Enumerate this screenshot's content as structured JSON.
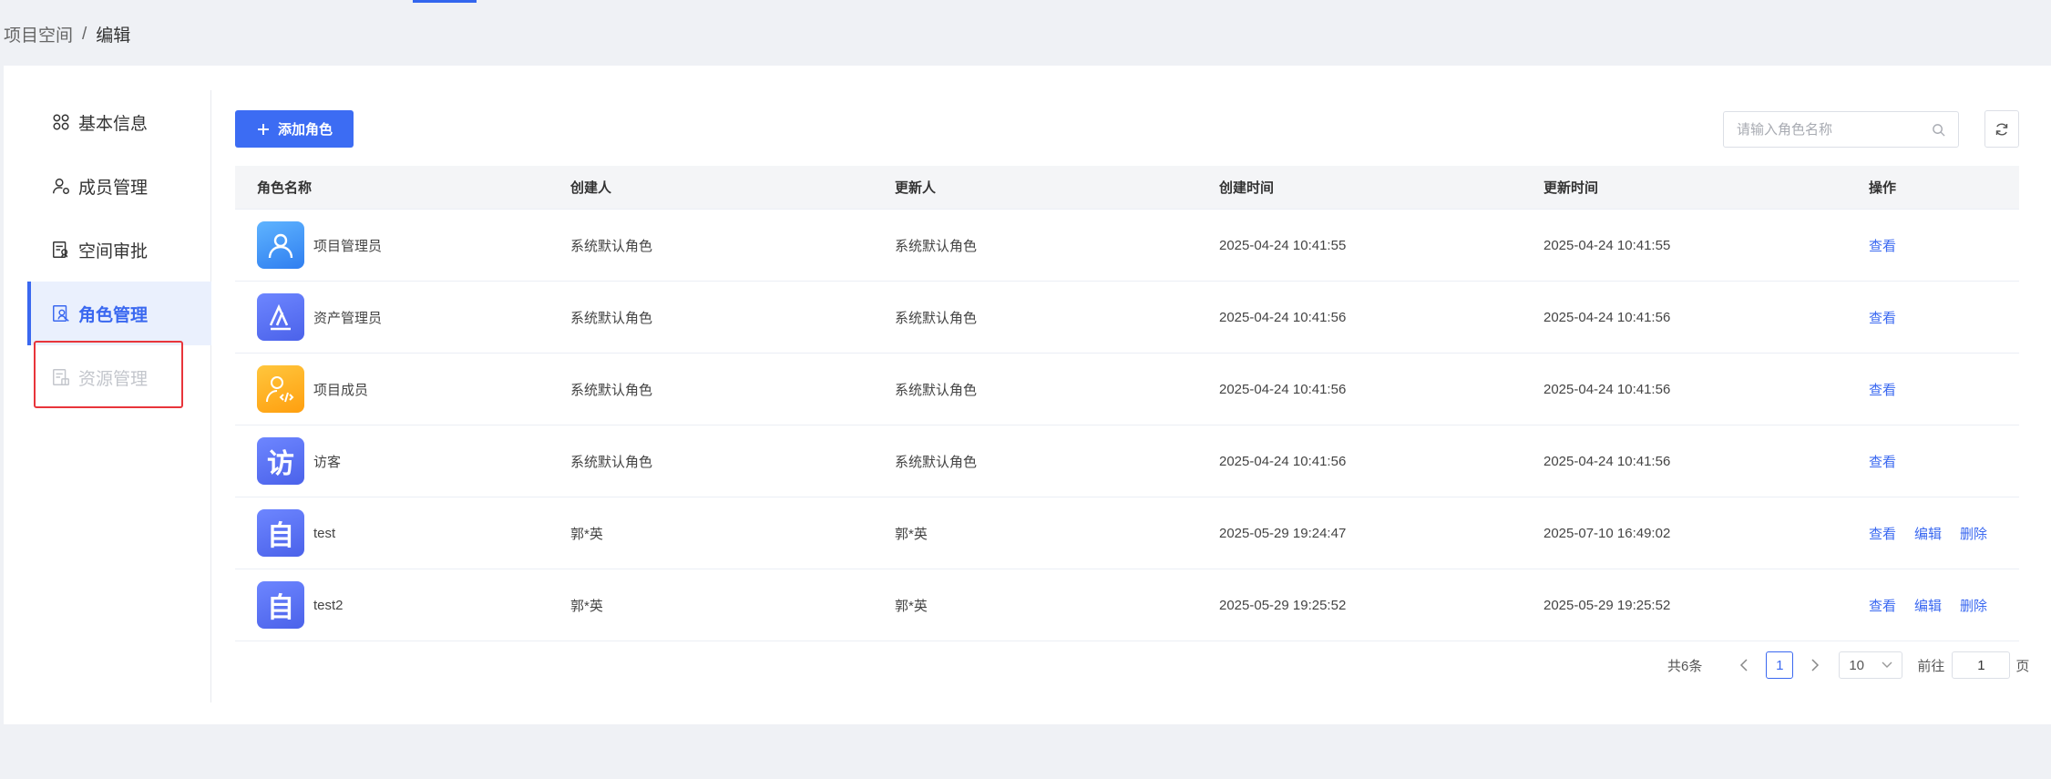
{
  "breadcrumb": {
    "parent": "项目空间",
    "separator": "/",
    "current": "编辑"
  },
  "sidebar": {
    "items": [
      {
        "label": "基本信息",
        "icon": "grid-icon",
        "state": "normal"
      },
      {
        "label": "成员管理",
        "icon": "user-settings-icon",
        "state": "normal"
      },
      {
        "label": "空间审批",
        "icon": "approval-icon",
        "state": "normal"
      },
      {
        "label": "角色管理",
        "icon": "role-icon",
        "state": "active"
      },
      {
        "label": "资源管理",
        "icon": "resource-icon",
        "state": "disabled"
      }
    ]
  },
  "toolbar": {
    "add_label": "添加角色",
    "search_placeholder": "请输入角色名称"
  },
  "table": {
    "headers": [
      "角色名称",
      "创建人",
      "更新人",
      "创建时间",
      "更新时间",
      "操作"
    ],
    "rows": [
      {
        "name": "项目管理员",
        "avatar": "person-icon",
        "creator": "系统默认角色",
        "updater": "系统默认角色",
        "created": "2025-04-24 10:41:55",
        "updated": "2025-04-24 10:41:55",
        "actions": [
          "查看"
        ]
      },
      {
        "name": "资产管理员",
        "avatar": "asset-icon",
        "creator": "系统默认角色",
        "updater": "系统默认角色",
        "created": "2025-04-24 10:41:56",
        "updated": "2025-04-24 10:41:56",
        "actions": [
          "查看"
        ]
      },
      {
        "name": "项目成员",
        "avatar": "developer-icon",
        "creator": "系统默认角色",
        "updater": "系统默认角色",
        "created": "2025-04-24 10:41:56",
        "updated": "2025-04-24 10:41:56",
        "actions": [
          "查看"
        ]
      },
      {
        "name": "访客",
        "avatar": "访",
        "creator": "系统默认角色",
        "updater": "系统默认角色",
        "created": "2025-04-24 10:41:56",
        "updated": "2025-04-24 10:41:56",
        "actions": [
          "查看"
        ]
      },
      {
        "name": "test",
        "avatar": "自",
        "creator": "郭*英",
        "updater": "郭*英",
        "created": "2025-05-29 19:24:47",
        "updated": "2025-07-10 16:49:02",
        "actions": [
          "查看",
          "编辑",
          "删除"
        ]
      },
      {
        "name": "test2",
        "avatar": "自",
        "creator": "郭*英",
        "updater": "郭*英",
        "created": "2025-05-29 19:25:52",
        "updated": "2025-05-29 19:25:52",
        "actions": [
          "查看",
          "编辑",
          "删除"
        ]
      }
    ]
  },
  "pagination": {
    "total": "共6条",
    "current_page": "1",
    "page_size": "10",
    "goto_label": "前往",
    "goto_value": "1",
    "page_unit": "页"
  },
  "colors": {
    "accent": "#3a68f0",
    "highlight": "#e8353b"
  }
}
